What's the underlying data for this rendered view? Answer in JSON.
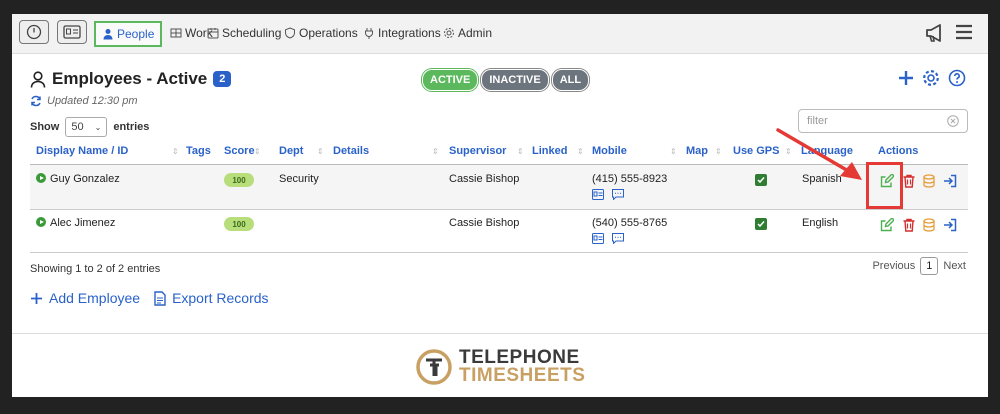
{
  "nav": {
    "items": [
      "People",
      "Work",
      "Scheduling",
      "Operations",
      "Integrations",
      "Admin"
    ]
  },
  "header": {
    "title": "Employees - Active",
    "count": "2",
    "updated": "Updated 12:30 pm",
    "filters": [
      "ACTIVE",
      "INACTIVE",
      "ALL"
    ]
  },
  "controls": {
    "show_label": "Show",
    "page_size": "50",
    "entries_label": "entries",
    "filter_placeholder": "filter"
  },
  "table": {
    "columns": [
      "Display Name / ID",
      "Tags",
      "Score",
      "Dept",
      "Details",
      "Supervisor",
      "Linked",
      "Mobile",
      "Map",
      "Use GPS",
      "Language",
      "Actions"
    ],
    "rows": [
      {
        "name": "Guy Gonzalez",
        "score": "100",
        "dept": "Security",
        "supervisor": "Cassie Bishop",
        "mobile": "(415) 555-8923",
        "gps": true,
        "language": "Spanish"
      },
      {
        "name": "Alec Jimenez",
        "score": "100",
        "dept": "",
        "supervisor": "Cassie Bishop",
        "mobile": "(540) 555-8765",
        "gps": true,
        "language": "English"
      }
    ]
  },
  "footer": {
    "entries_info": "Showing 1 to 2 of 2 entries",
    "previous": "Previous",
    "current_page": "1",
    "next": "Next",
    "add_employee": "Add Employee",
    "export_records": "Export Records"
  },
  "logo": {
    "line1": "TELEPHONE",
    "line2": "TIMESHEETS"
  },
  "colors": {
    "accent": "#2a62c9",
    "active": "#5cb85c",
    "highlight": "#e53935"
  }
}
